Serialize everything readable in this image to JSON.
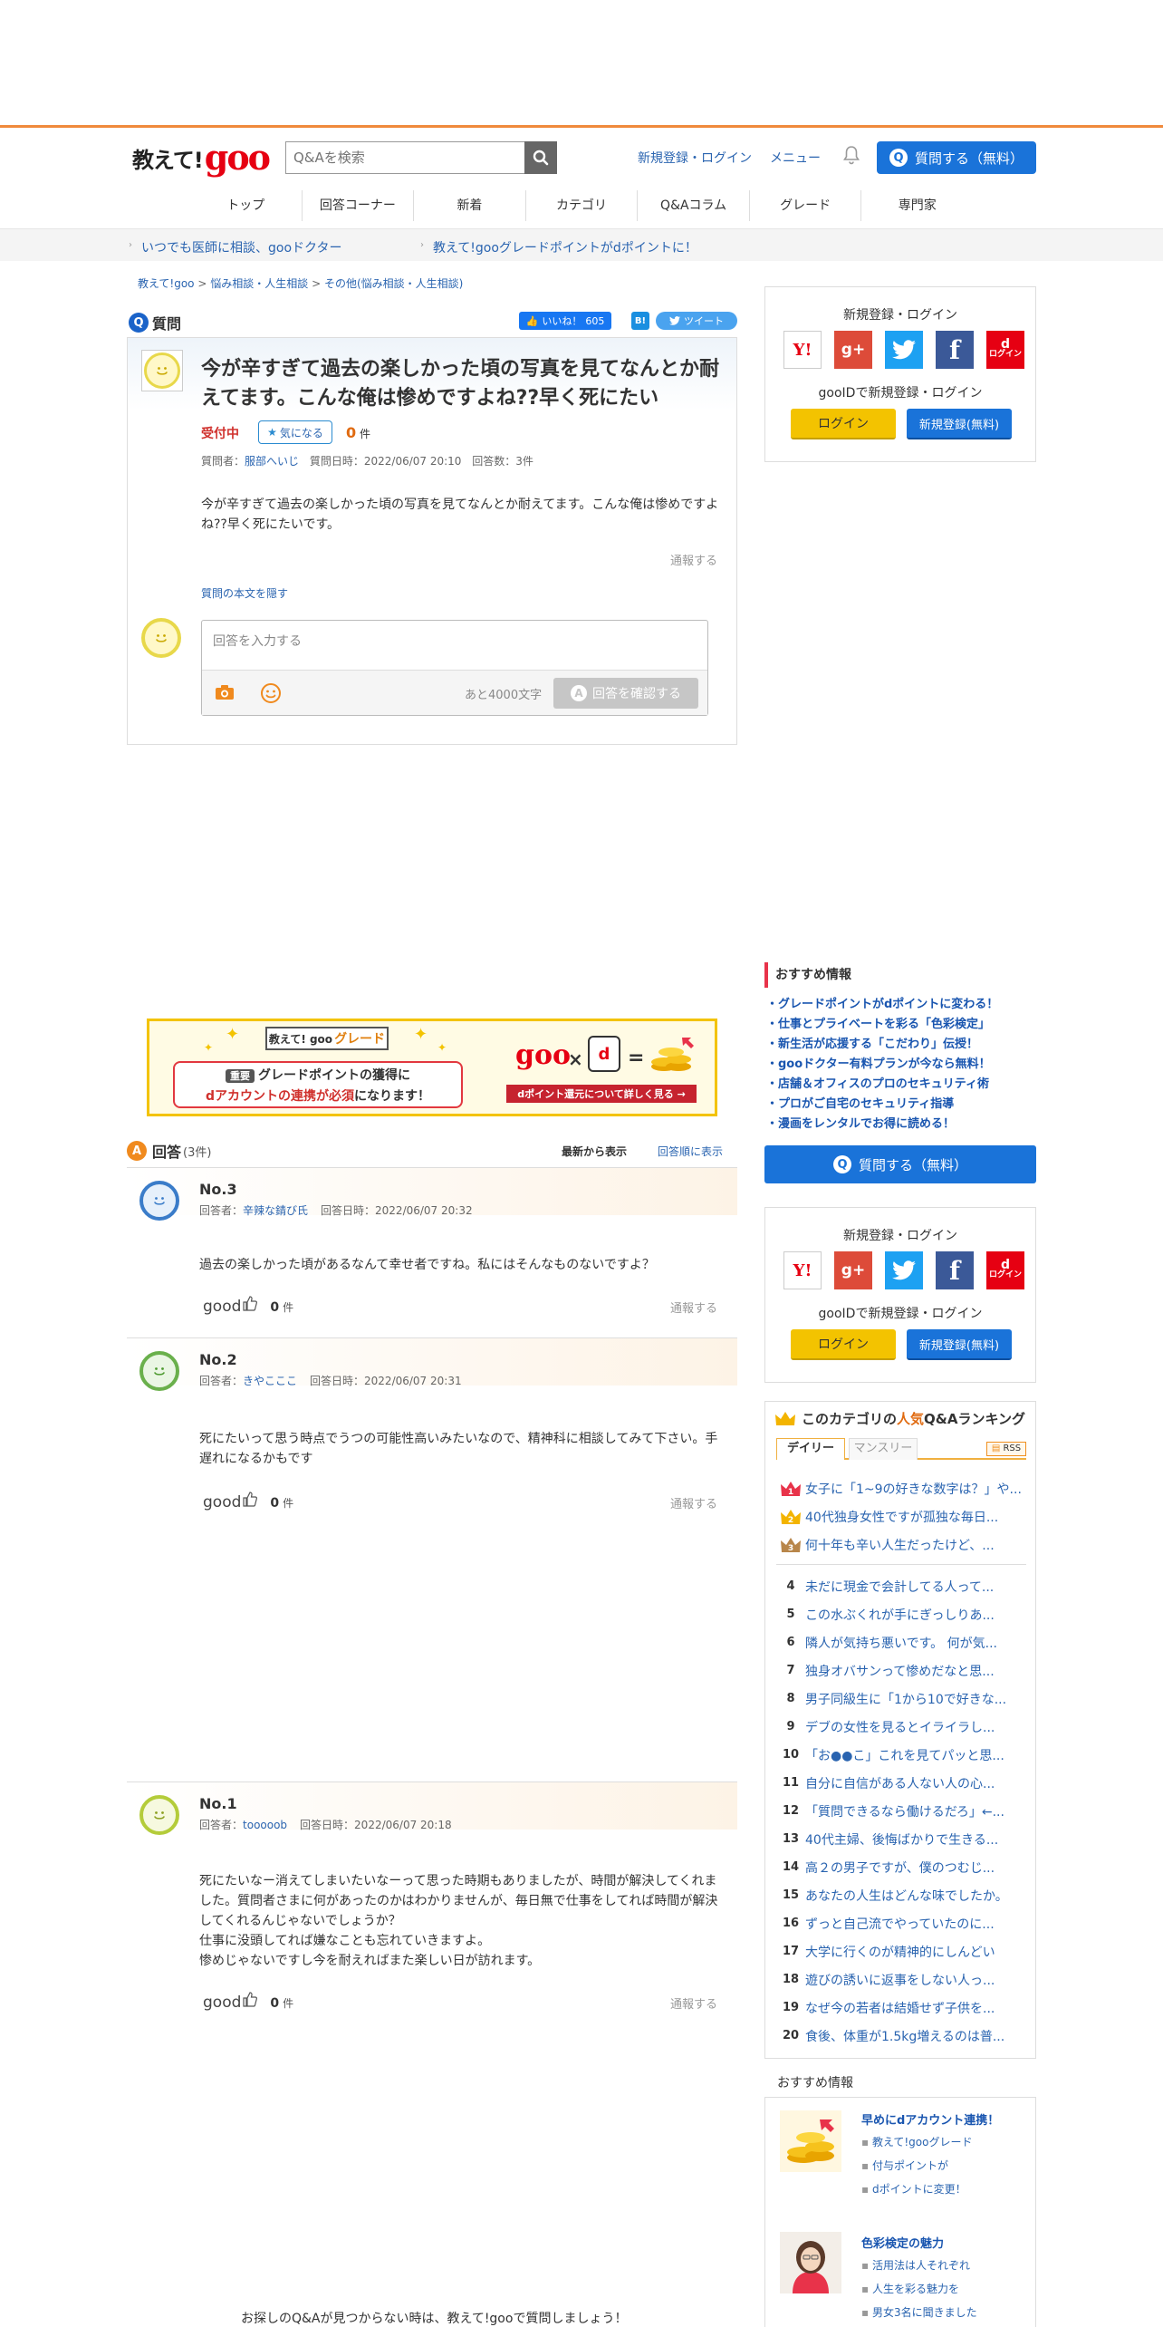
{
  "header": {
    "logo_text": "教えて!",
    "logo_brand": "goo",
    "search_placeholder": "Q&Aを検索",
    "login_link": "新規登録・ログイン",
    "menu_link": "メニュー",
    "ask_button": "質問する（無料）"
  },
  "nav": [
    "トップ",
    "回答コーナー",
    "新着",
    "カテゴリ",
    "Q&Aコラム",
    "グレード",
    "専門家"
  ],
  "subbar": {
    "left": "いつでも医師に相談、gooドクター",
    "right": "教えて!gooグレードポイントがdポイントに！"
  },
  "breadcrumb": [
    "教えて!goo",
    "悩み相談・人生相談",
    "その他(悩み相談・人生相談)"
  ],
  "question": {
    "section_label": "質問",
    "like_label": "いいね！",
    "like_count": "605",
    "hatena_label": "B!",
    "tweet_label": "ツイート",
    "title": "今が辛すぎて過去の楽しかった頃の写真を見てなんとか耐えてます。こんな俺は惨めですよね??早く死にたい",
    "status": "受付中",
    "kininaru_label": "気になる",
    "kininaru_count": "0",
    "kininaru_unit": "件",
    "meta_asker_label": "質問者：",
    "meta_asker": "服部へいじ",
    "meta_date": "質問日時：2022/06/07 20:10",
    "meta_answers": "回答数：3件",
    "body": "今が辛すぎて過去の楽しかった頃の写真を見てなんとか耐えてます。こんな俺は惨めですよね??早く死にたいです。",
    "report": "通報する",
    "hide_link": "質問の本文を隠す",
    "answer_placeholder": "回答を入力する",
    "chars_left": "あと4000文字",
    "confirm_button": "回答を確認する"
  },
  "banner": {
    "tag_prefix": "教えて! goo",
    "tag_grade": "グレード",
    "important": "重要",
    "line1": "グレードポイントの獲得に",
    "line2_red": "dアカウントの連携が必須",
    "line2_rest": "になります！",
    "goo": "goo",
    "x": "×",
    "d": "d",
    "eq": "=",
    "cta": "dポイント還元について詳しく見る →"
  },
  "answers_section": {
    "label": "回答",
    "count": "(3件)",
    "sort_new": "最新から表示",
    "sort_old": "回答順に表示"
  },
  "answers": [
    {
      "no": "No.3",
      "meta_label": "回答者：",
      "author": "辛辣な錆び氏",
      "date": "回答日時：2022/06/07 20:32",
      "body": "過去の楽しかった頃があるなんて幸せ者ですね。私にはそんなものないですよ？",
      "good": "good",
      "good_count": "0",
      "good_unit": "件",
      "report": "通報する"
    },
    {
      "no": "No.2",
      "meta_label": "回答者：",
      "author": "きやこここ",
      "date": "回答日時：2022/06/07 20:31",
      "body": "死にたいって思う時点でうつの可能性高いみたいなので、精神科に相談してみて下さい。手遅れになるかもです",
      "good": "good",
      "good_count": "0",
      "good_unit": "件",
      "report": "通報する"
    },
    {
      "no": "No.1",
      "meta_label": "回答者：",
      "author": "tooooob",
      "date": "回答日時：2022/06/07 20:18",
      "body1": "死にたいなー消えてしまいたいなーって思った時期もありましたが、時間が解決してくれました。質問者さまに何があったのかはわかりませんが、毎日無で仕事をしてれば時間が解決してくれるんじゃないでしょうか？",
      "body2": "仕事に没頭してれば嫌なことも忘れていきますよ。",
      "body3": "惨めじゃないですし今を耐えればまた楽しい日が訪れます。",
      "good": "good",
      "good_count": "0",
      "good_unit": "件",
      "report": "通報する"
    }
  ],
  "sidebar": {
    "login_title": "新規登録・ログイン",
    "gooid": "gooIDで新規登録・ログイン",
    "login_button": "ログイン",
    "signup_button": "新規登録(無料)",
    "sns": {
      "yahoo": "Y!",
      "gplus": "g+",
      "fb": "f",
      "d_top": "d",
      "d_bottom": "ログイン"
    },
    "reco_title": "おすすめ情報",
    "reco_items": [
      "・グレードポイントがdポイントに変わる！",
      "・仕事とプライベートを彩る「色彩検定」",
      "・新生活が応援する「こだわり」伝授！",
      "・gooドクター有料プランが今なら無料！",
      "・店舗＆オフィスのプロのセキュリティ術",
      "・プロがご自宅のセキュリティ指導",
      "・漫画をレンタルでお得に読める！"
    ],
    "ask_button": "質問する（無料）",
    "ranking": {
      "title_prefix": "このカテゴリの",
      "title_hl": "人気",
      "title_suffix": "Q&Aランキング",
      "tab_daily": "デイリー",
      "tab_monthly": "マンスリー",
      "rss": "RSS",
      "top3": [
        "女子に「1~9の好きな数字は？」や...",
        "40代独身女性ですが孤独な毎日...",
        "何十年も辛い人生だったけど、..."
      ],
      "rest": [
        {
          "n": "4",
          "t": "未だに現金で会計してる人って..."
        },
        {
          "n": "5",
          "t": "この水ぶくれが手にぎっしりあ..."
        },
        {
          "n": "6",
          "t": "隣人が気持ち悪いです。 何が気..."
        },
        {
          "n": "7",
          "t": "独身オバサンって惨めだなと思..."
        },
        {
          "n": "8",
          "t": "男子同級生に「1から10で好きな..."
        },
        {
          "n": "9",
          "t": "デブの女性を見るとイライラし..."
        },
        {
          "n": "10",
          "t": "「お●●こ」これを見てパッと思..."
        },
        {
          "n": "11",
          "t": "自分に自信がある人ない人の心..."
        },
        {
          "n": "12",
          "t": "「質問できるなら働けるだろ」←..."
        },
        {
          "n": "13",
          "t": "40代主婦、後悔ばかりで生きる..."
        },
        {
          "n": "14",
          "t": "高２の男子ですが、僕のつむじ..."
        },
        {
          "n": "15",
          "t": "あなたの人生はどんな味でしたか。"
        },
        {
          "n": "16",
          "t": "ずっと自己流でやっていたのに..."
        },
        {
          "n": "17",
          "t": "大学に行くのが精神的にしんどい"
        },
        {
          "n": "18",
          "t": "遊びの誘いに返事をしない人っ..."
        },
        {
          "n": "19",
          "t": "なぜ今の若者は結婚せず子供を..."
        },
        {
          "n": "20",
          "t": "食後、体重が1.5kg増えるのは普..."
        }
      ]
    },
    "reco2_title": "おすすめ情報",
    "reco2": [
      {
        "head": "早めにdアカウント連携！",
        "lines": [
          "教えて!gooグレード",
          "付与ポイントが",
          "dポイントに変更！"
        ]
      },
      {
        "head": "色彩検定の魅力",
        "lines": [
          "活用法は人それぞれ",
          "人生を彩る魅力を",
          "男女3名に聞きました"
        ]
      }
    ]
  },
  "bottom_message": "お探しのQ&Aが見つからない時は、教えて!gooで質問しましょう！",
  "colors": {
    "accent_orange": "#f08a3c",
    "brand_red": "#e60012",
    "primary_blue": "#1a73d9",
    "link": "#2a64b0"
  }
}
